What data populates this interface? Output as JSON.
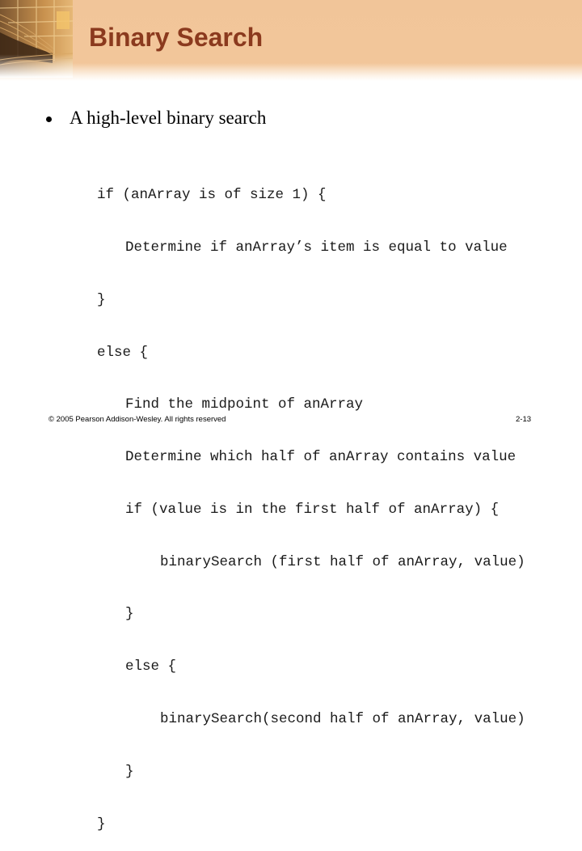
{
  "slide": {
    "title": "Binary Search",
    "colors": {
      "title": "#8b3a1e",
      "header_band": "#f2c69a"
    }
  },
  "content": {
    "bullet": "A high-level binary search",
    "code_lines": [
      {
        "indent": 0,
        "text": "if (anArray is of size 1) {"
      },
      {
        "indent": 1,
        "text": "Determine if anArray’s item is equal to value"
      },
      {
        "indent": 0,
        "text": "}"
      },
      {
        "indent": 0,
        "text": "else {"
      },
      {
        "indent": 1,
        "text": "Find the midpoint of anArray"
      },
      {
        "indent": 1,
        "text": "Determine which half of anArray contains value"
      },
      {
        "indent": 1,
        "text": "if (value is in the first half of anArray) {"
      },
      {
        "indent": 2,
        "text": "binarySearch (first half of anArray, value)"
      },
      {
        "indent": 1,
        "text": "}"
      },
      {
        "indent": 1,
        "text": "else {"
      },
      {
        "indent": 2,
        "text": "binarySearch(second half of anArray, value)"
      },
      {
        "indent": 1,
        "text": "}"
      },
      {
        "indent": 0,
        "text": "}"
      }
    ]
  },
  "footer": {
    "copyright": "© 2005 Pearson Addison-Wesley. All rights reserved",
    "page_number": "2-13"
  },
  "icons": {
    "header_photo": "staircase-building-photo"
  }
}
